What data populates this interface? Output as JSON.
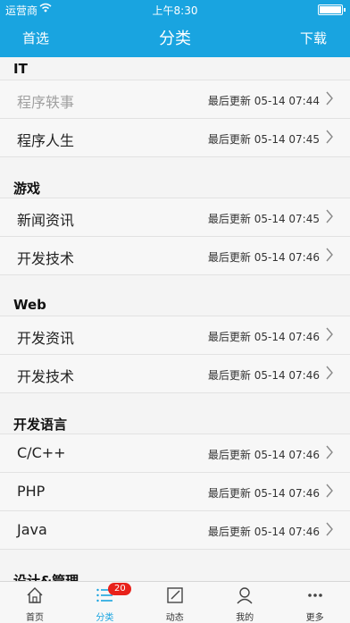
{
  "status_bar": {
    "carrier": "运营商",
    "wifi_icon": "wifi-icon",
    "time": "上午8:30",
    "battery_level": 1.0
  },
  "nav": {
    "left_label": "首选",
    "title": "分类",
    "right_label": "下载"
  },
  "sections": [
    {
      "title": "IT",
      "items": [
        {
          "name": "程序轶事",
          "updated": "最后更新 05-14 07:44"
        },
        {
          "name": "程序人生",
          "updated": "最后更新 05-14 07:45"
        }
      ]
    },
    {
      "title": "游戏",
      "items": [
        {
          "name": "新闻资讯",
          "updated": "最后更新 05-14 07:45"
        },
        {
          "name": "开发技术",
          "updated": "最后更新 05-14 07:46"
        }
      ]
    },
    {
      "title": "Web",
      "items": [
        {
          "name": "开发资讯",
          "updated": "最后更新 05-14 07:46"
        },
        {
          "name": "开发技术",
          "updated": "最后更新 05-14 07:46"
        }
      ]
    },
    {
      "title": "开发语言",
      "items": [
        {
          "name": "C/C++",
          "updated": "最后更新 05-14 07:46"
        },
        {
          "name": "PHP",
          "updated": "最后更新 05-14 07:46"
        },
        {
          "name": "Java",
          "updated": "最后更新 05-14 07:46"
        }
      ]
    },
    {
      "title": "设计&管理",
      "items": []
    }
  ],
  "tabbar": {
    "tabs": [
      {
        "label": "首页",
        "icon": "home-icon"
      },
      {
        "label": "分类",
        "icon": "list-icon",
        "badge": "20",
        "active": true
      },
      {
        "label": "动态",
        "icon": "edit-icon"
      },
      {
        "label": "我的",
        "icon": "user-icon"
      },
      {
        "label": "更多",
        "icon": "more-icon"
      }
    ]
  },
  "colors": {
    "accent": "#19a4e0",
    "badge": "#e8221b",
    "background": "#f4f4f4"
  }
}
